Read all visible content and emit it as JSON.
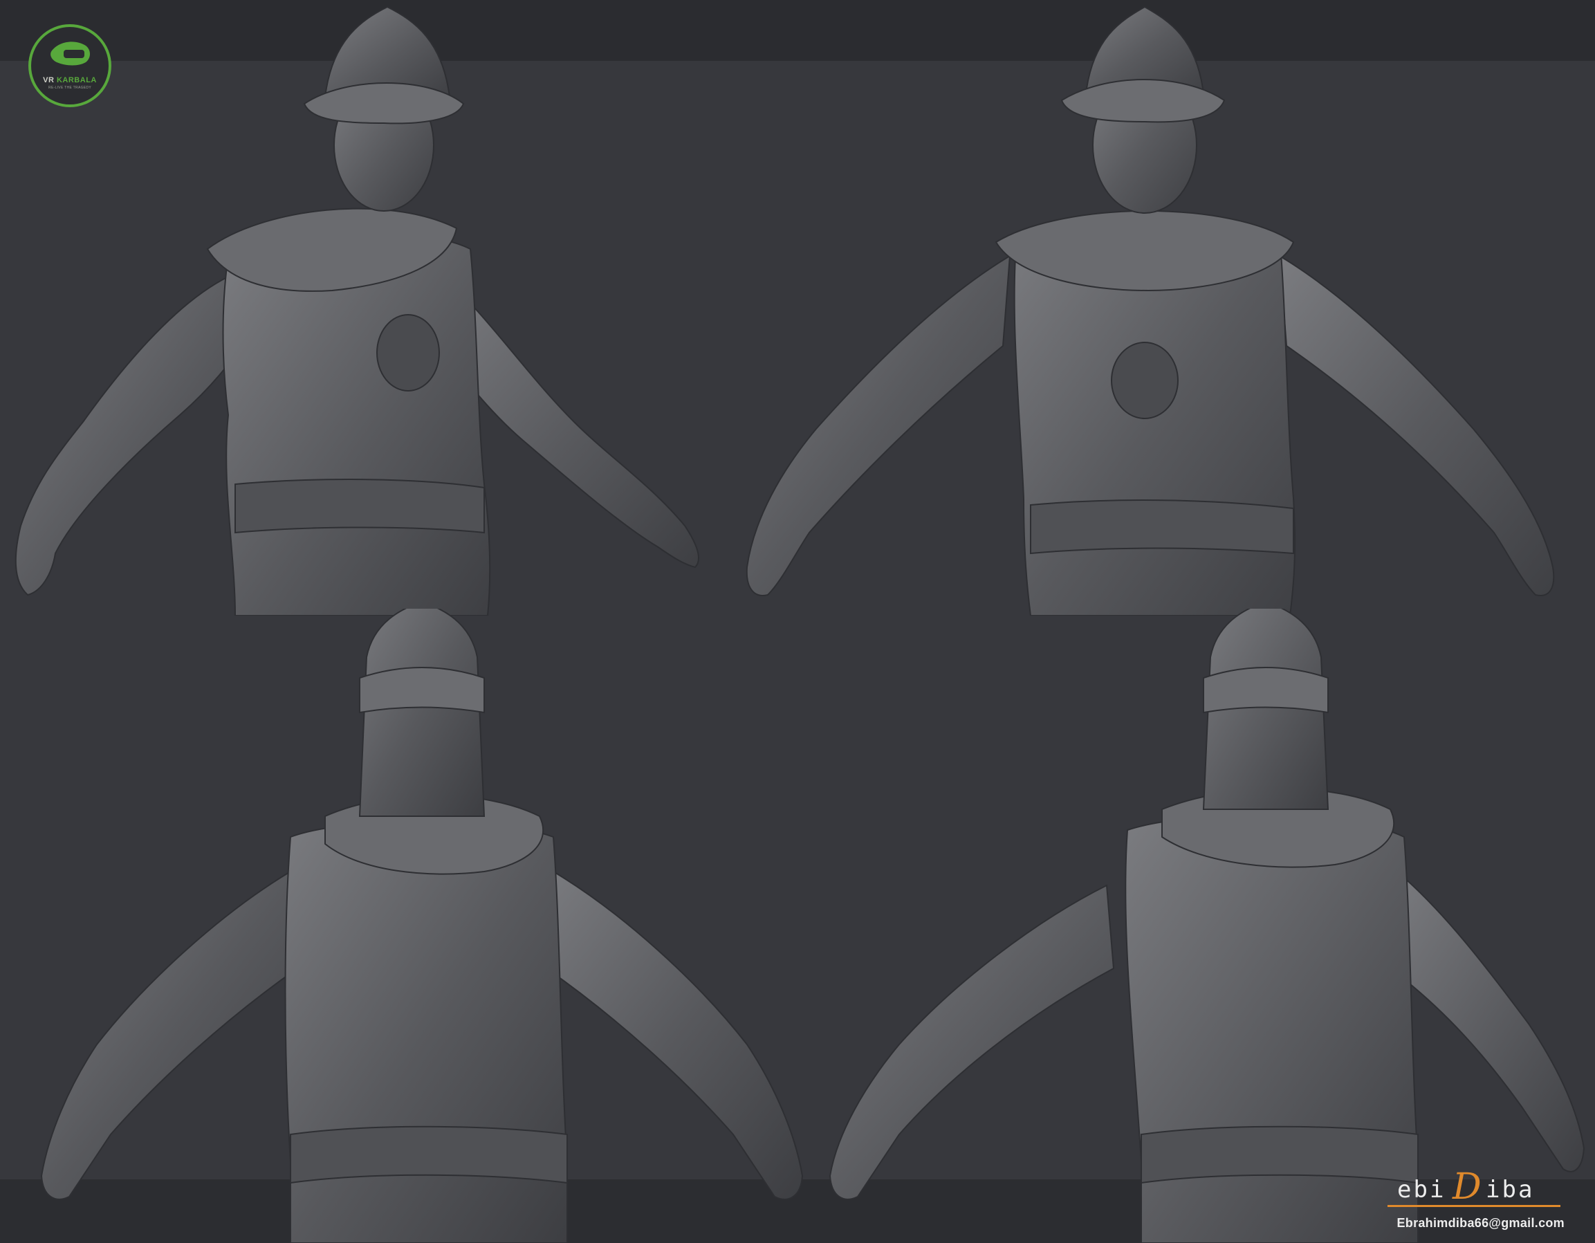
{
  "logo": {
    "wordmark_prefix": "VR",
    "wordmark_accent": "KARBALA",
    "tagline": "RE-LIVE THE TRAGEDY",
    "brand_color": "#58a83c"
  },
  "signature": {
    "part1": "ebi",
    "part2": "D",
    "part3": "iba",
    "accent_color": "#e08a2c"
  },
  "contact": {
    "email": "Ebrahimdiba66@gmail.com"
  },
  "views": [
    {
      "name": "front three-quarter view"
    },
    {
      "name": "front view"
    },
    {
      "name": "back view"
    },
    {
      "name": "back three-quarter view"
    }
  ],
  "colors": {
    "background": "#37383d",
    "sculpt": "#5a5b5f",
    "sculpt_highlight": "#808185",
    "sculpt_shadow": "#37383b"
  }
}
